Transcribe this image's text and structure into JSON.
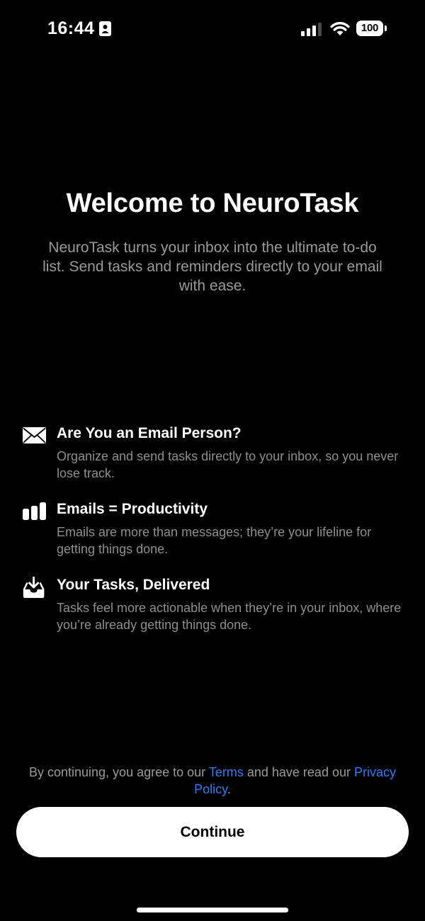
{
  "status_bar": {
    "time": "16:44",
    "battery": "100",
    "icons": [
      "id-badge-icon",
      "cellular-signal-icon",
      "wifi-icon",
      "battery-icon"
    ]
  },
  "header": {
    "title": "Welcome to NeuroTask",
    "subtitle": "NeuroTask turns your inbox into the ultimate to-do list. Send tasks and reminders directly to your email with ease."
  },
  "features": [
    {
      "icon": "envelope-icon",
      "title": "Are You an Email Person?",
      "description": "Organize and send tasks directly to your inbox, so you never lose track."
    },
    {
      "icon": "bar-chart-icon",
      "title": "Emails = Productivity",
      "description": "Emails are more than messages; they’re your lifeline for getting things done."
    },
    {
      "icon": "inbox-download-icon",
      "title": "Your Tasks, Delivered",
      "description": "Tasks feel more actionable when they’re in your inbox, where you’re already getting things done."
    }
  ],
  "footer": {
    "legal_prefix": "By continuing, you agree to our",
    "terms_link": "Terms",
    "legal_middle": "and have read our",
    "privacy_link": "Privacy Policy",
    "legal_suffix": ".",
    "continue_label": "Continue"
  },
  "colors": {
    "background": "#000000",
    "text_primary": "#ffffff",
    "text_secondary": "#9a9a9a",
    "link": "#2f7cf6",
    "button_bg": "#ffffff",
    "button_text": "#000000"
  }
}
